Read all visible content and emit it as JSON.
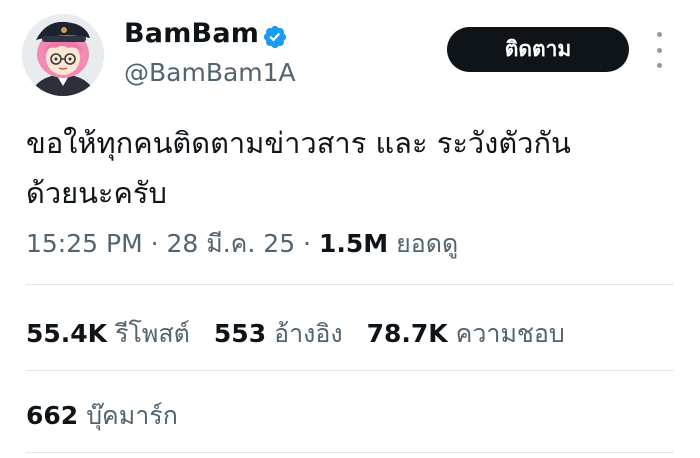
{
  "author": {
    "name": "BamBam",
    "handle": "@BamBam1A",
    "verified": true
  },
  "follow_button": {
    "label": "ติดตาม"
  },
  "tweet": {
    "text_line1": "ขอให้ทุกคนติดตามข่าวสาร และ ระวังตัวกัน",
    "text_line2": "ด้วยนะครับ"
  },
  "meta": {
    "time": "15:25 PM",
    "sep1": " · ",
    "date": "28 มี.ค. 25",
    "sep2": " · ",
    "views_count": "1.5M",
    "views_label": " ยอดดู"
  },
  "stats": [
    {
      "count": "55.4K",
      "label": "รีโพสต์"
    },
    {
      "count": "553",
      "label": "อ้างอิง"
    },
    {
      "count": "78.7K",
      "label": "ความชอบ"
    }
  ],
  "bookmarks": {
    "count": "662",
    "label": "บุ๊คมาร์ก"
  },
  "colors": {
    "text": "#0f1419",
    "secondary": "#536471",
    "verified_blue": "#1d9bf0",
    "button_bg": "#0f1419",
    "divider": "#e1e6ea"
  },
  "icons": {
    "verified": "verified-badge-icon",
    "more": "more-options-icon"
  }
}
